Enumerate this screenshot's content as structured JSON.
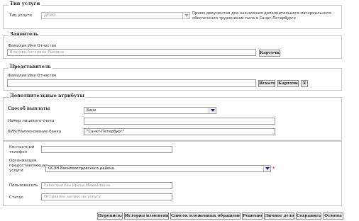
{
  "service_type": {
    "legend": "Тип услуги",
    "label": "Тип услуги",
    "value": "ДЕМО",
    "note_line1": "Прием документов для назначения дополнительного материального",
    "note_line2": "обеспечения труженикам тыла в Санкт-Петербурге"
  },
  "applicant": {
    "legend": "Заявитель",
    "fio_label": "Фамилия Имя Отчество",
    "fio_value": "Власова Ангелина Львовна",
    "card_button": "Карточка"
  },
  "representative": {
    "legend": "Представитель",
    "fio_label": "Фамилия Имя Отчество",
    "fio_value": "",
    "search_button": "Искать",
    "card_button": "Карточка",
    "clear_button": "X"
  },
  "extra": {
    "legend": "Дополнительные атрибуты",
    "payment_label": "Способ выплаты",
    "payment_value": "Банк",
    "account_label": "Номер лицевого счета",
    "account_value": "",
    "bik_label": "БИК/Наименование банка",
    "bik_value": "\"Санкт-Петербург\"",
    "phone_label_1": "Контактный",
    "phone_label_2": "телефон",
    "phone_value": "",
    "org_label_1": "Организация,",
    "org_label_2": "предоставляющая",
    "org_label_3": "услуги",
    "org_value": "ОСЗН Василеостровского района",
    "required_mark": "*",
    "user_label": "Пользователь",
    "user_value": "Регистратова Ирина Михайловна",
    "status_label": "Статус",
    "status_value": "Отправлен запрос на услугу"
  },
  "footer_buttons": [
    "Переписка",
    "История изменений",
    "Список вложенных обращений",
    "Решение",
    "Личное дело",
    "Сохранить",
    "Отмена"
  ],
  "icons": {
    "dropdown": "chevron-down-icon"
  },
  "colors": {
    "dropdown_arrow": "#1b2a8c",
    "required": "#cc0000",
    "border": "#c8c8c8"
  }
}
